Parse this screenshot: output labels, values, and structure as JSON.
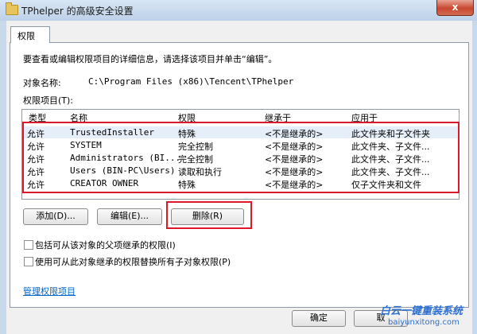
{
  "window": {
    "title": "TPhelper 的高级安全设置",
    "close_glyph": "x"
  },
  "tabs": [
    {
      "label": "权限"
    }
  ],
  "info_text": "要查看或编辑权限项目的详细信息，请选择该项目并单击“编辑”。",
  "object_name_label": "对象名称:",
  "object_name_value": "C:\\Program Files (x86)\\Tencent\\TPhelper",
  "entries_label": "权限项目(T):",
  "columns": [
    "类型",
    "名称",
    "权限",
    "继承于",
    "应用于"
  ],
  "rows": [
    {
      "type": "允许",
      "name": "TrustedInstaller",
      "permission": "特殊",
      "inherited": "<不是继承的>",
      "applies": "此文件夹和子文件夹"
    },
    {
      "type": "允许",
      "name": "SYSTEM",
      "permission": "完全控制",
      "inherited": "<不是继承的>",
      "applies": "此文件夹、子文件..."
    },
    {
      "type": "允许",
      "name": "Administrators (BI...",
      "permission": "完全控制",
      "inherited": "<不是继承的>",
      "applies": "此文件夹、子文件..."
    },
    {
      "type": "允许",
      "name": "Users (BIN-PC\\Users)",
      "permission": "读取和执行",
      "inherited": "<不是继承的>",
      "applies": "此文件夹、子文件..."
    },
    {
      "type": "允许",
      "name": "CREATOR OWNER",
      "permission": "特殊",
      "inherited": "<不是继承的>",
      "applies": "仅子文件夹和文件"
    }
  ],
  "buttons": {
    "add": "添加(D)...",
    "edit": "编辑(E)...",
    "delete": "删除(R)",
    "ok": "确定",
    "cancel": "取"
  },
  "checkboxes": [
    {
      "label": "包括可从该对象的父项继承的权限(I)",
      "checked": false
    },
    {
      "label": "使用可从此对象继承的权限替换所有子对象权限(P)",
      "checked": false
    }
  ],
  "manage_link": "管理权限项目",
  "watermark": {
    "line1": "白云一键重装系统",
    "line2": "baiyunxitong.com"
  },
  "colors": {
    "highlight": "#e0162b",
    "link": "#0066cc"
  }
}
